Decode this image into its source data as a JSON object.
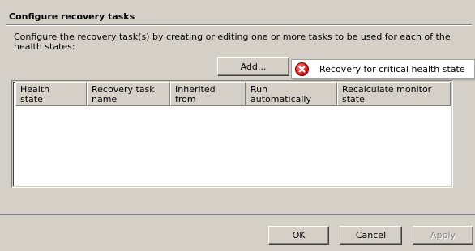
{
  "section": {
    "title": "Configure recovery tasks",
    "description": "Configure the recovery task(s) by creating or editing one or more tasks to be used for each of the health states:"
  },
  "add_button": {
    "label": "Add..."
  },
  "dropdown": {
    "item_label": "Recovery for critical health state",
    "item_icon": "error-icon"
  },
  "grid": {
    "columns": [
      "Health\nstate",
      "Recovery task\nname",
      "Inherited\nfrom",
      "Run\nautomatically",
      "Recalculate monitor\nstate"
    ],
    "rows": []
  },
  "footer": {
    "ok_label": "OK",
    "cancel_label": "Cancel",
    "apply_label": "Apply",
    "apply_enabled": false
  }
}
